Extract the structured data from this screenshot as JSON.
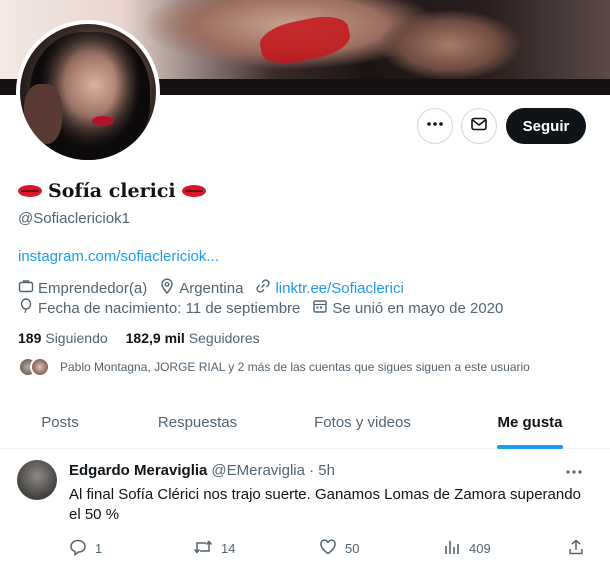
{
  "profile": {
    "display_name": "Sofía clerici",
    "handle": "@Sofiaclericiok1",
    "link": "instagram.com/sofiaclericiok...",
    "category": "Emprendedor(a)",
    "location": "Argentina",
    "website": "linktr.ee/Sofiaclerici",
    "birthday": "Fecha de nacimiento: 11 de septiembre",
    "joined": "Se unió en mayo de 2020",
    "following_count": "189",
    "following_label": "Siguiendo",
    "followers_count": "182,9 mil",
    "followers_label": "Seguidores",
    "followers_you_know": "Pablo Montagna, JORGE RIAL y 2 más de las cuentas que sigues siguen a este usuario"
  },
  "actions": {
    "follow_label": "Seguir"
  },
  "tabs": [
    {
      "label": "Posts"
    },
    {
      "label": "Respuestas"
    },
    {
      "label": "Fotos y videos"
    },
    {
      "label": "Me gusta"
    }
  ],
  "tweet": {
    "author": "Edgardo Meraviglia",
    "handle_time": "@EMeraviglia · 5h",
    "text": "Al final Sofía Clérici nos trajo suerte.  Ganamos Lomas de Zamora superando el 50 %",
    "replies": "1",
    "retweets": "14",
    "likes": "50",
    "views": "409"
  },
  "icons": {
    "more": "more-dots-icon",
    "mail": "mail-icon",
    "briefcase": "briefcase-icon",
    "location": "location-pin-icon",
    "link": "link-icon",
    "balloon": "birthday-balloon-icon",
    "calendar": "calendar-icon",
    "reply": "reply-icon",
    "retweet": "retweet-icon",
    "like": "heart-icon",
    "views": "views-chart-icon",
    "share": "share-icon"
  },
  "colors": {
    "accent": "#1d9bf0",
    "text": "#0f1419",
    "muted": "#536471",
    "follow_bg": "#0f1419"
  }
}
